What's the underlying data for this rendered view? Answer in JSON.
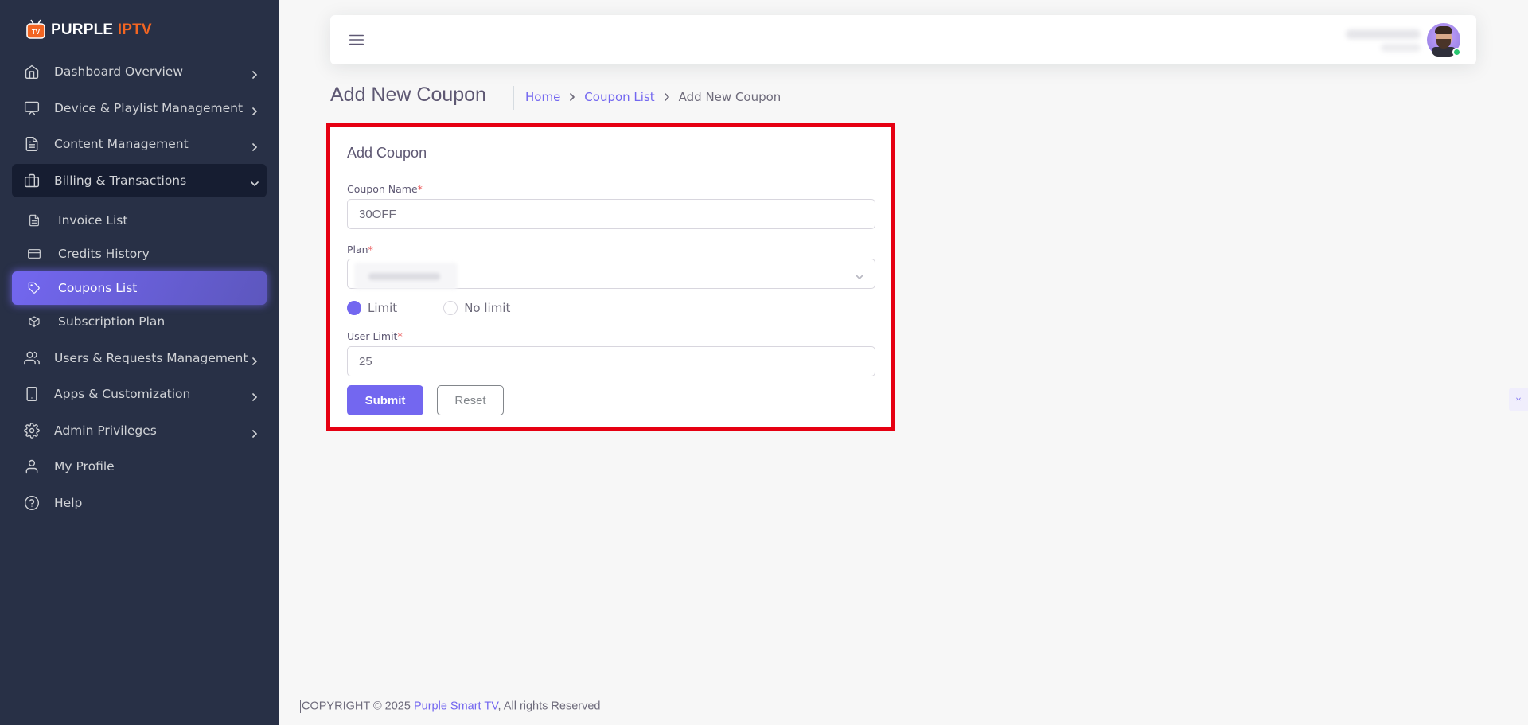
{
  "brand": {
    "name_white": "PURPLE",
    "name_orange": "IPTV",
    "icon_label": "TV"
  },
  "sidebar": {
    "items": [
      {
        "label": "Dashboard Overview"
      },
      {
        "label": "Device & Playlist Management"
      },
      {
        "label": "Content Management"
      },
      {
        "label": "Billing & Transactions"
      },
      {
        "label": "Users & Requests Management"
      },
      {
        "label": "Apps & Customization"
      },
      {
        "label": "Admin Privileges"
      },
      {
        "label": "My Profile"
      },
      {
        "label": "Help"
      }
    ],
    "billing_sub": [
      {
        "label": "Invoice List"
      },
      {
        "label": "Credits History"
      },
      {
        "label": "Coupons List"
      },
      {
        "label": "Subscription Plan"
      }
    ]
  },
  "page": {
    "title": "Add New Coupon"
  },
  "breadcrumb": {
    "home": "Home",
    "list": "Coupon List",
    "current": "Add New Coupon"
  },
  "form": {
    "card_title": "Add Coupon",
    "coupon_name_label": "Coupon Name",
    "coupon_name_value": "30OFF",
    "plan_label": "Plan",
    "required_mark": "*",
    "limit_label": "Limit",
    "no_limit_label": "No limit",
    "user_limit_label": "User Limit",
    "user_limit_value": "25",
    "submit_label": "Submit",
    "reset_label": "Reset"
  },
  "footer": {
    "prefix": "COPYRIGHT © 2025 ",
    "brand": "Purple Smart TV",
    "suffix": ", All rights Reserved"
  },
  "colors": {
    "accent": "#7367f0",
    "sidebar_bg": "#283046",
    "highlight_border": "#e60012"
  }
}
